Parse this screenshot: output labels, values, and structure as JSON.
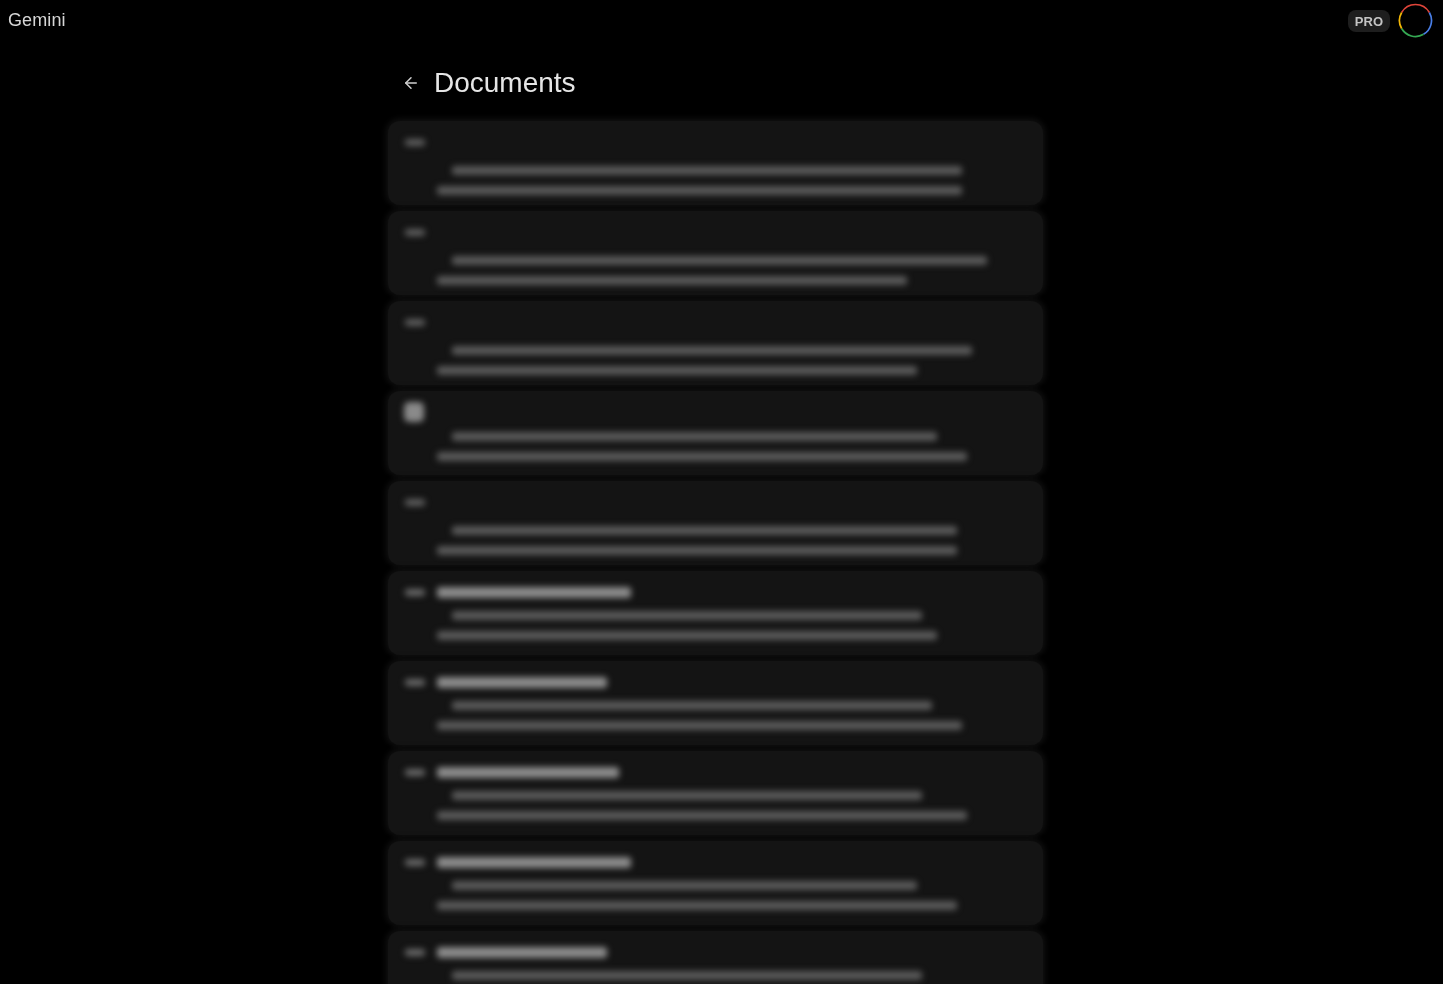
{
  "app": {
    "name": "Gemini"
  },
  "header": {
    "plan_badge": "PRO"
  },
  "page": {
    "title": "Documents"
  },
  "documents": [
    {
      "kind": "snippet"
    },
    {
      "kind": "snippet"
    },
    {
      "kind": "snippet"
    },
    {
      "kind": "file"
    },
    {
      "kind": "snippet"
    },
    {
      "kind": "titled"
    },
    {
      "kind": "titled"
    },
    {
      "kind": "titled"
    },
    {
      "kind": "titled"
    },
    {
      "kind": "titled"
    }
  ]
}
